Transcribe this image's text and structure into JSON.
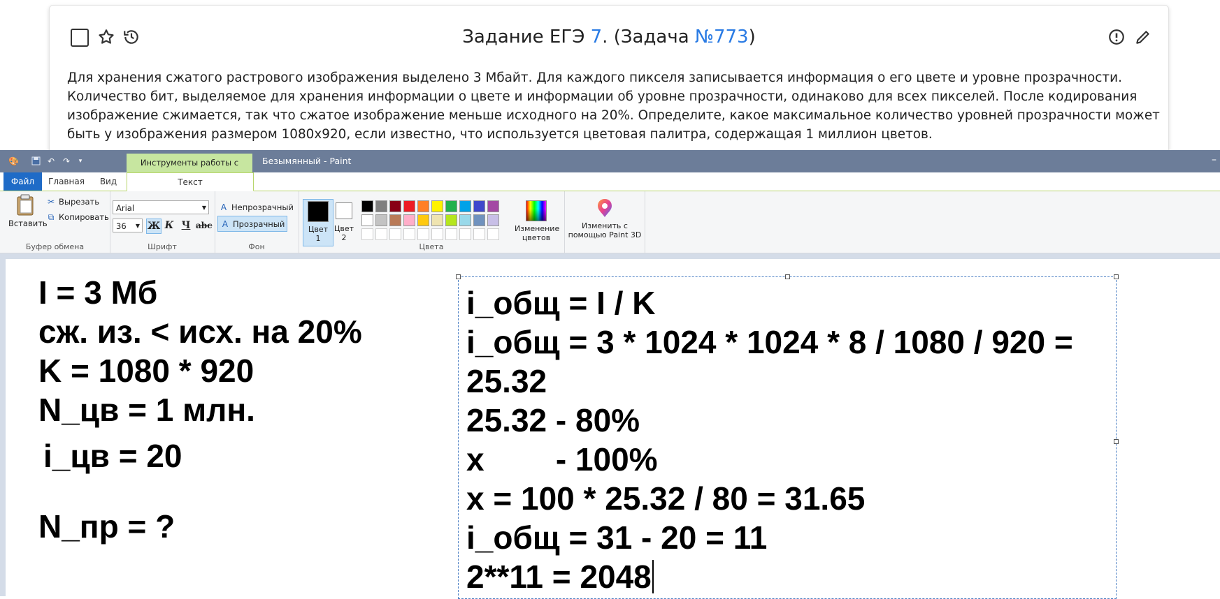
{
  "task_card": {
    "title_prefix": "Задание ЕГЭ ",
    "task_number": "7",
    "title_middle": ". (Задача ",
    "task_id": "№773",
    "title_suffix": ")",
    "text": "Для хранения сжатого растрового изображения выделено 3 Мбайт. Для каждого пикселя записывается информация о его цвете и уровне прозрачности. Количество бит, выделяемое для хранения информации о цвете и информации об уровне прозрачности, одинаково для всех пикселей. После кодирования изображение сжимается, так что сжатое изображение меньше исходного на 20%. Определите, какое максимальное количество уровней прозрачности может быть у изображения размером 1080x920, если известно, что используется цветовая палитра, содержащая 1 миллион цветов.",
    "icons": [
      "checkbox-icon",
      "star-icon",
      "history-icon",
      "report-icon",
      "edit-icon"
    ]
  },
  "paint": {
    "context_tab": "Инструменты работы с текстом",
    "window_title": "Безымянный - Paint",
    "tabs": [
      "Файл",
      "Главная",
      "Вид",
      "Текст"
    ],
    "clipboard": {
      "paste": "Вставить",
      "cut": "Вырезать",
      "copy": "Копировать",
      "label": "Буфер обмена"
    },
    "font": {
      "family": "Arial",
      "size": "36",
      "bold": "Ж",
      "italic": "К",
      "underline": "Ч",
      "strike": "abc",
      "label": "Шрифт"
    },
    "background": {
      "opaque": "Непрозрачный",
      "transparent": "Прозрачный",
      "label": "Фон"
    },
    "colors": {
      "color1_label": "Цвет 1",
      "color2_label": "Цвет 2",
      "edit_label": "Изменение цветов",
      "label": "Цвета",
      "color1": "#000000",
      "color2": "#ffffff",
      "palette_row1": [
        "#000000",
        "#7f7f7f",
        "#880015",
        "#ed1c24",
        "#ff7f27",
        "#fff200",
        "#22b14c",
        "#00a2e8",
        "#3f48cc",
        "#a349a4"
      ],
      "palette_row2": [
        "#ffffff",
        "#c3c3c3",
        "#b97a57",
        "#ffaec9",
        "#ffc90e",
        "#efe4b0",
        "#b5e61d",
        "#99d9ea",
        "#7092be",
        "#c8bfe7"
      ]
    },
    "paint3d_label": "Изменить с помощью Paint 3D"
  },
  "canvas": {
    "left_notes": [
      "I = 3 Мб",
      "сж. из. < исх. на 20%",
      "K = 1080 * 920",
      "N_цв = 1 млн.",
      "i_цв = 20",
      "N_пр = ?"
    ],
    "solution": [
      "i_общ = I / K",
      "i_общ = 3 * 1024 * 1024 * 8 / 1080 / 920 =",
      "25.32",
      "25.32 - 80%",
      "x        - 100%",
      "x = 100 * 25.32 / 80 = 31.65",
      "i_общ = 31 - 20 = 11",
      "2**11 = 2048"
    ]
  }
}
